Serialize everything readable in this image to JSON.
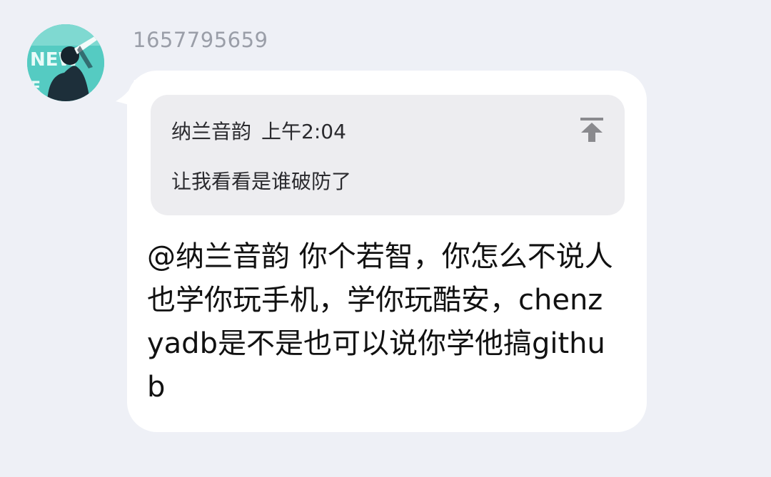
{
  "message": {
    "sender_id": "1657795659",
    "avatar_icon": "user-avatar-icon",
    "quote": {
      "author": "纳兰音韵",
      "time": "上午2:04",
      "text": "让我看看是谁破防了",
      "jump_icon": "jump-to-quoted-icon"
    },
    "text": "@纳兰音韵 你个若智，你怎么不说人也学你玩手机，学你玩酷安，chenzyadb是不是也可以说你学他搞github"
  },
  "colors": {
    "background": "#eef0f6",
    "bubble": "#ffffff",
    "quote_background": "#ededf0",
    "sender_id": "#9a9ea8",
    "text": "#111111"
  }
}
